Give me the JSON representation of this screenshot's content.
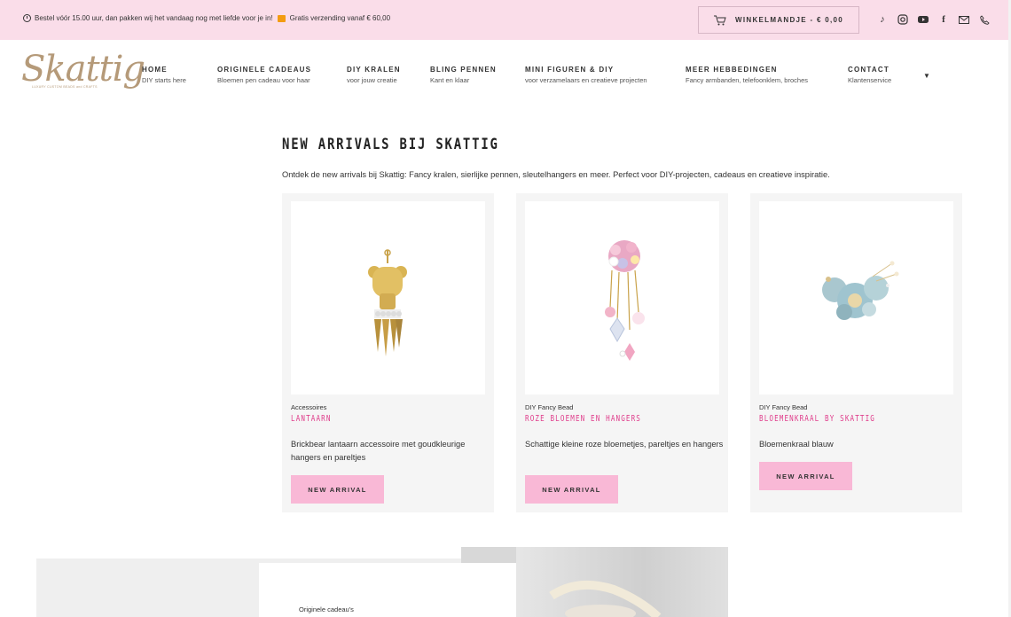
{
  "topbar": {
    "notice": "Bestel vóór 15.00 uur, dan pakken wij het vandaag nog met liefde voor je in!",
    "shipping": "Gratis verzending vanaf € 60,00",
    "cart_label": "WINKELMANDJE - € 0,00",
    "socials": [
      "tiktok-icon",
      "instagram-icon",
      "youtube-icon",
      "facebook-icon",
      "mail-icon",
      "phone-icon"
    ]
  },
  "logo": {
    "name": "Skattig",
    "tagline": "LUXURY CUSTOM BEADS and CRAFTS"
  },
  "nav": [
    {
      "title": "HOME",
      "sub": "DIY starts here"
    },
    {
      "title": "ORIGINELE CADEAUS",
      "sub": "Bloemen pen cadeau voor haar"
    },
    {
      "title": "DIY KRALEN",
      "sub": "voor jouw creatie"
    },
    {
      "title": "BLING PENNEN",
      "sub": "Kant en klaar"
    },
    {
      "title": "MINI FIGUREN & DIY",
      "sub": "voor verzamelaars en creatieve projecten"
    },
    {
      "title": "MEER HEBBEDINGEN",
      "sub": "Fancy armbanden, telefoonklem, broches"
    },
    {
      "title": "CONTACT",
      "sub": "Klantenservice"
    }
  ],
  "main": {
    "title": "NEW ARRIVALS BIJ SKATTIG",
    "intro": "Ontdek de new arrivals bij Skattig: Fancy kralen, sierlijke pennen, sleutelhangers en meer. Perfect voor DIY-projecten, cadeaus en creatieve inspiratie."
  },
  "products": [
    {
      "category": "Accessoires",
      "name": "LANTAARN",
      "desc": "Brickbear lantaarn accessoire met goudkleurige hangers en pareltjes",
      "button": "NEW ARRIVAL"
    },
    {
      "category": "DIY Fancy Bead",
      "name": "ROZE BLOEMEN EN HANGERS",
      "desc": "Schattige kleine roze bloemetjes, pareltjes en hangers",
      "button": "NEW ARRIVAL"
    },
    {
      "category": "DIY Fancy Bead",
      "name": "BLOEMENKRAAL BY SKATTIG",
      "desc": "Bloemenkraal blauw",
      "button": "NEW ARRIVAL"
    }
  ],
  "bottom": {
    "label": "Originele cadeau's"
  },
  "colors": {
    "topbar": "#fadde9",
    "accent": "#e0408d",
    "button": "#f9b8d6",
    "logo": "#b59a79"
  }
}
